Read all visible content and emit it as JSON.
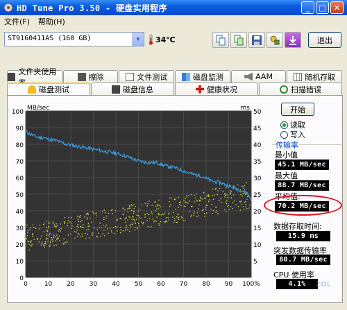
{
  "window": {
    "title": "HD Tune Pro 3.50 - 硬盘实用程序",
    "minimize": "_",
    "maximize": "□",
    "close": "✕"
  },
  "menu": {
    "items": [
      "文件(F)",
      "帮助(H)"
    ]
  },
  "toolbar": {
    "drive": "ST9160411AS (160 GB)",
    "temperature": "34℃",
    "exit_label": "退出",
    "buttons": [
      "copy-text-icon",
      "copy-screen-icon",
      "save-icon",
      "options-icon",
      "download-icon"
    ]
  },
  "tabs_top": [
    "文件夹使用率",
    "擦除",
    "文件测试",
    "磁盘监测",
    "AAM",
    "随机存取"
  ],
  "tabs_bottom": [
    "磁盘测试",
    "磁盘信息",
    "健康状况",
    "扫描错误"
  ],
  "active_tab": "磁盘测试",
  "side": {
    "start_label": "开始",
    "radio_read": "读取",
    "radio_write": "写入",
    "selected": "read",
    "group_title": "传输率",
    "min_label": "最小值",
    "min_value": "45.1 MB/sec",
    "max_label": "最大值",
    "max_value": "88.7 MB/sec",
    "avg_label": "平均值:",
    "avg_value": "70.2 MB/sec",
    "access_label": "数据存取时间:",
    "access_value": "15.9 ms",
    "burst_label": "突发数据传输率",
    "burst_value": "80.7 MB/sec",
    "cpu_label": "CPU 使用率",
    "cpu_value": "4.1%"
  },
  "watermark": "ZOL",
  "chart_data": {
    "type": "line",
    "ylabel_left": "MB/sec",
    "ylabel_right": "ms",
    "ylim_left": [
      0,
      100
    ],
    "ylim_right": [
      0,
      50
    ],
    "left_ticks": [
      "100",
      "90",
      "80",
      "70",
      "60",
      "50",
      "40",
      "30",
      "20",
      "10",
      "0"
    ],
    "right_ticks": [
      "50",
      "45",
      "40",
      "35",
      "30",
      "25",
      "20",
      "15",
      "10",
      "5"
    ],
    "x_ticks": [
      "0",
      "10",
      "20",
      "30",
      "40",
      "50",
      "60",
      "70",
      "80",
      "90",
      "100%"
    ],
    "grid": true,
    "series": [
      {
        "color": "#3aa0e8",
        "x": [
          0,
          2,
          4,
          6,
          8,
          10,
          14,
          18,
          22,
          26,
          30,
          34,
          38,
          42,
          46,
          50,
          54,
          58,
          62,
          66,
          70,
          74,
          78,
          82,
          86,
          90,
          94,
          98,
          100
        ],
        "values": [
          88,
          86,
          85,
          84,
          84,
          83,
          82,
          80,
          79,
          78,
          77,
          76,
          75,
          74,
          72,
          70,
          69,
          69,
          67,
          66,
          64,
          62,
          61,
          58,
          57,
          55,
          53,
          51,
          47
        ]
      }
    ],
    "scatter": {
      "color": "#e8e04a",
      "trend_ms_start": 12,
      "trend_ms_end": 25,
      "trend_ms_spread": 4
    }
  }
}
